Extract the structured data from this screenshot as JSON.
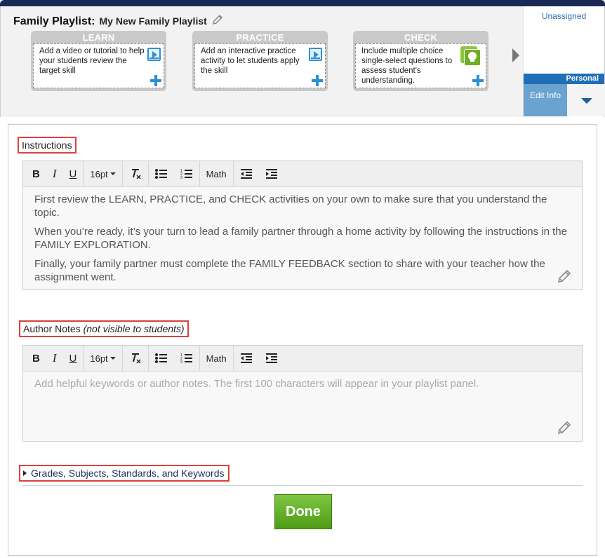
{
  "header": {
    "title": "Family Playlist:",
    "playlist_name": "My New Family Playlist"
  },
  "cards": [
    {
      "heading": "LEARN",
      "text": "Add a video or tutorial to help your students review the target skill",
      "icon": "video-icon"
    },
    {
      "heading": "PRACTICE",
      "text": "Add an interactive practice activity to let students apply the skill",
      "icon": "video-icon"
    },
    {
      "heading": "CHECK",
      "text": "Include multiple choice single-select questions to assess student's understanding.",
      "icon": "lightbulb-icon"
    }
  ],
  "side_panel": {
    "status": "Unassigned",
    "band_label": "Personal",
    "edit_info": "Edit Info"
  },
  "toolbar": {
    "font_size": "16pt",
    "math": "Math"
  },
  "instructions": {
    "label": "Instructions",
    "paragraphs": [
      "First review the LEARN, PRACTICE, and CHECK activities on your own to make sure that you understand the topic.",
      "When you’re ready, it’s your turn to lead a family partner through a home activity by following the instructions in the FAMILY EXPLORATION.",
      "Finally, your family partner must complete the FAMILY FEEDBACK section to share with your teacher how the assignment went."
    ]
  },
  "author_notes": {
    "label": "Author Notes",
    "label_note": "(not visible to students)",
    "placeholder": "Add helpful keywords or author notes. The first 100 characters will appear in your playlist panel."
  },
  "grades_section": {
    "label": "Grades, Subjects, Standards, and Keywords"
  },
  "done_button": "Done",
  "colors": {
    "accent_blue": "#1f6fb6",
    "highlight_red": "#d9413c",
    "done_green": "#5fae22",
    "topbar_navy": "#1b2a55"
  }
}
